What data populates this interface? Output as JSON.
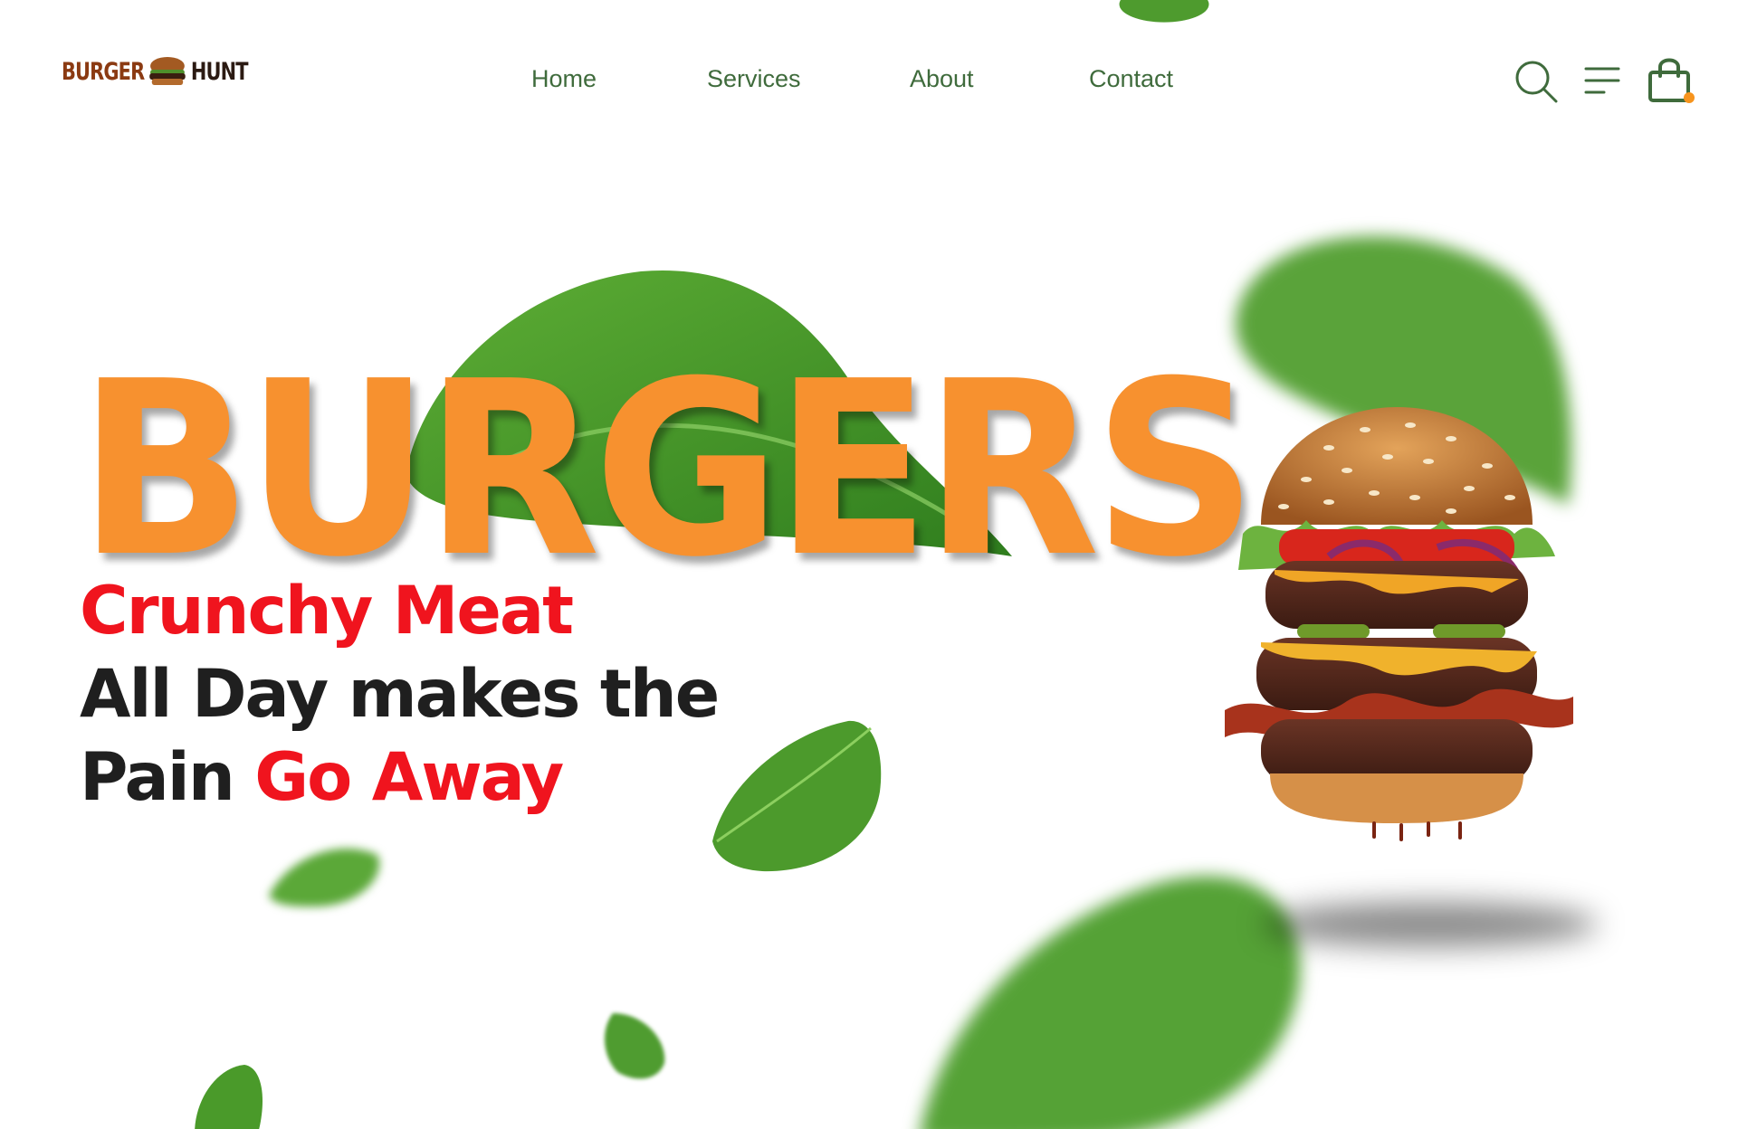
{
  "brand": {
    "word1": "BURGER",
    "word2": "HUNT"
  },
  "nav": {
    "items": [
      {
        "label": "Home"
      },
      {
        "label": "Services"
      },
      {
        "label": "About"
      },
      {
        "label": "Contact"
      }
    ]
  },
  "header_icons": {
    "search": "search-icon",
    "menu": "menu-icon",
    "cart": "shopping-bag-icon"
  },
  "hero": {
    "title": "BURGERS",
    "tagline_line1": "Crunchy Meat",
    "tagline_line2": "All Day makes the",
    "tagline_line3_plain": "Pain ",
    "tagline_line3_highlight": "Go Away"
  },
  "colors": {
    "accent_orange": "#f7912f",
    "highlight_red": "#f0141e",
    "nav_green": "#3f6b3c",
    "text_dark": "#1f1f1f",
    "cart_dot": "#f7941d"
  }
}
